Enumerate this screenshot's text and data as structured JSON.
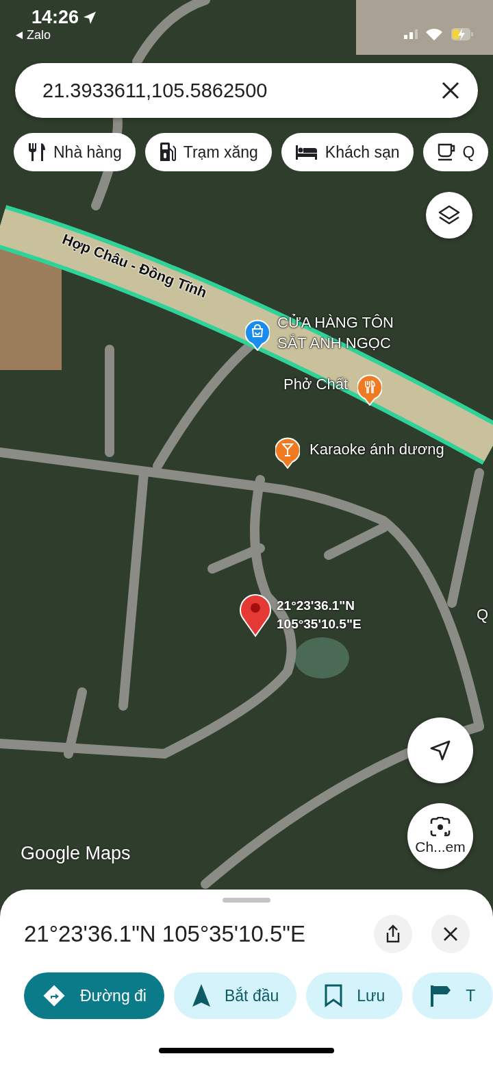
{
  "status_bar": {
    "time": "14:26",
    "back_app": "Zalo"
  },
  "search": {
    "value": "21.3933611,105.5862500"
  },
  "chips": [
    {
      "kind": "restaurant",
      "label": "Nhà hàng"
    },
    {
      "kind": "gas",
      "label": "Trạm xăng"
    },
    {
      "kind": "hotel",
      "label": "Khách sạn"
    },
    {
      "kind": "cafe",
      "label": "Q"
    }
  ],
  "map": {
    "road_label": "Hợp Châu - Đồng Tĩnh",
    "places": [
      {
        "kind": "shop",
        "name": "CỬA HÀNG TÔN SẮT ANH NGỌC",
        "color": "#1a8cf0"
      },
      {
        "kind": "restaurant",
        "name": "Phở Chất",
        "color": "#f07a22"
      },
      {
        "kind": "bar",
        "name": "Karaoke ánh dương",
        "color": "#f07a22"
      },
      {
        "kind": "label",
        "name": "Q"
      }
    ],
    "pin_label": [
      "21°23'36.1\"N",
      "105°35'10.5\"E"
    ],
    "lens_label": "Ch...em",
    "logo": "Google Maps"
  },
  "sheet": {
    "title": "21°23'36.1\"N 105°35'10.5\"E",
    "actions": [
      {
        "kind": "directions",
        "label": "Đường đi",
        "filled": true
      },
      {
        "kind": "start",
        "label": "Bắt đầu",
        "filled": false
      },
      {
        "kind": "save",
        "label": "Lưu",
        "filled": false
      },
      {
        "kind": "flag",
        "label": "T",
        "filled": false
      }
    ]
  }
}
